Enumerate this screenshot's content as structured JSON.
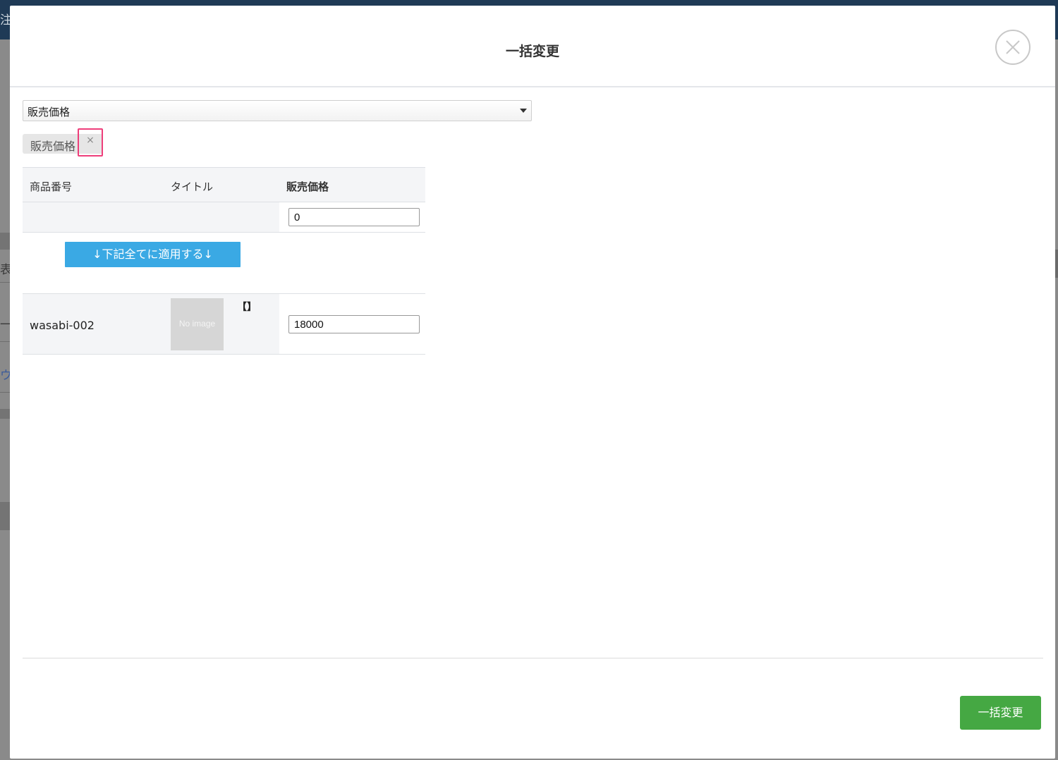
{
  "background": {
    "side_chars": [
      "注",
      "表",
      "一括",
      "ウ"
    ]
  },
  "modal": {
    "title": "一括変更",
    "field_select": {
      "selected": "販売価格"
    },
    "selected_tag": {
      "label": "販売価格",
      "remove_glyph": "×"
    },
    "table": {
      "headers": [
        "商品番号",
        "タイトル",
        "販売価格"
      ],
      "bulk_value": "0",
      "apply_button": "↓下記全てに適用する↓",
      "rows": [
        {
          "sku": "wasabi-002",
          "image_text": "No image",
          "title": "【】",
          "price": "18000"
        }
      ]
    },
    "submit_button": "一括変更"
  },
  "colors": {
    "apply_button": "#3aa9e4",
    "submit_button": "#45a843",
    "highlight_border": "#ee3e7a"
  }
}
